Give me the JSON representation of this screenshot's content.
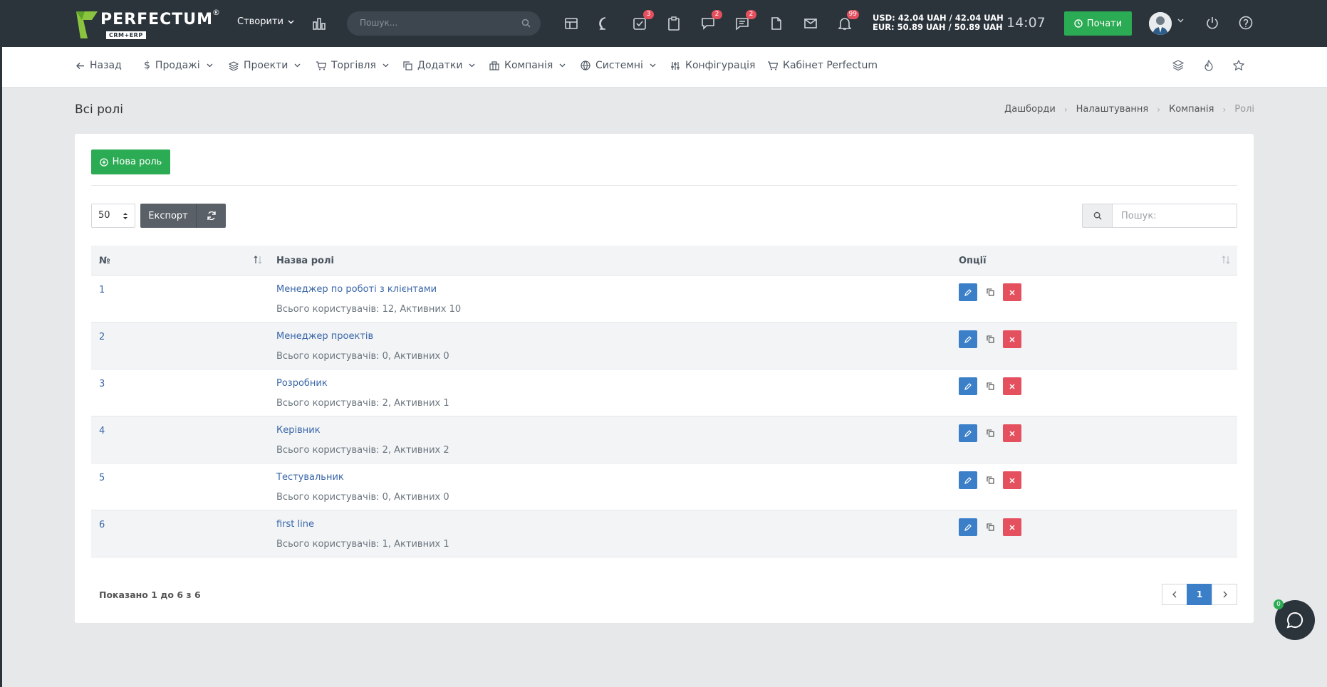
{
  "brand": {
    "name": "PERFECTUM",
    "sub": "CRM+ERP",
    "reg": "®"
  },
  "topbar": {
    "create_label": "Створити",
    "search_placeholder": "Пошук...",
    "badges": {
      "tasks": "3",
      "chat": "2",
      "messages": "2",
      "notifications": "99"
    },
    "rates_usd": "USD: 42.04 UAH / 42.04 UAH",
    "rates_eur": "EUR: 50.89 UAH / 50.89 UAH",
    "time": "14:07",
    "start_label": "Почати"
  },
  "nav": {
    "back": "Назад",
    "sales": "Продажі",
    "projects": "Проекти",
    "trade": "Торгівля",
    "addons": "Додатки",
    "company": "Компанія",
    "system": "Системні",
    "config": "Конфігурація",
    "cabinet": "Кабінет Perfectum"
  },
  "page": {
    "title": "Всі ролі",
    "breadcrumbs": [
      "Дашборди",
      "Налаштування",
      "Компанія",
      "Ролі"
    ]
  },
  "toolbar": {
    "new_role": "Нова роль",
    "page_length": "50",
    "export": "Експорт",
    "search_placeholder": "Пошук:"
  },
  "table": {
    "headers": {
      "num": "№",
      "name": "Назва ролі",
      "options": "Опції"
    },
    "rows": [
      {
        "num": "1",
        "name": "Менеджер по роботі з клієнтами",
        "stats": "Всього користувачів: 12, Активних 10"
      },
      {
        "num": "2",
        "name": "Менеджер проектів",
        "stats": "Всього користувачів: 0, Активних 0"
      },
      {
        "num": "3",
        "name": "Розробник",
        "stats": "Всього користувачів: 2, Активних 1"
      },
      {
        "num": "4",
        "name": "Керівник",
        "stats": "Всього користувачів: 2, Активних 2"
      },
      {
        "num": "5",
        "name": "Тестувальник",
        "stats": "Всього користувачів: 0, Активних 0"
      },
      {
        "num": "6",
        "name": "first line",
        "stats": "Всього користувачів: 1, Активних 1"
      }
    ]
  },
  "footer": {
    "showing": "Показано 1 до 6 з 6",
    "current_page": "1"
  },
  "chat": {
    "badge": "0"
  },
  "colors": {
    "topbar": "#2b333b",
    "green": "#2bab53",
    "blue": "#3a7fc8",
    "red": "#e5505e",
    "link": "#3a66a8"
  }
}
